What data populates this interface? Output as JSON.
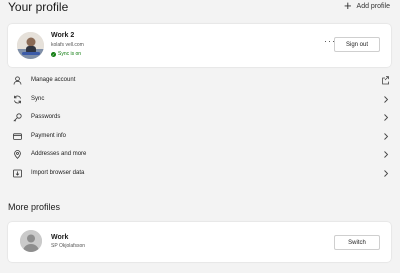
{
  "header": {
    "title": "Your profile",
    "add_profile_label": "Add profile"
  },
  "current_profile": {
    "name": "Work 2",
    "email": "kolafs          vell.com",
    "sync_status": "Sync is on",
    "sign_out_label": "Sign out"
  },
  "menu": {
    "items": [
      {
        "label": "Manage account",
        "icon": "person-icon",
        "trailing": "external-link-icon"
      },
      {
        "label": "Sync",
        "icon": "sync-icon",
        "trailing": "chevron-right-icon"
      },
      {
        "label": "Passwords",
        "icon": "key-icon",
        "trailing": "chevron-right-icon"
      },
      {
        "label": "Payment info",
        "icon": "credit-card-icon",
        "trailing": "chevron-right-icon"
      },
      {
        "label": "Addresses and more",
        "icon": "location-pin-icon",
        "trailing": "chevron-right-icon"
      },
      {
        "label": "Import browser data",
        "icon": "import-icon",
        "trailing": "chevron-right-icon"
      }
    ]
  },
  "more_profiles": {
    "title": "More profiles",
    "profiles": [
      {
        "name": "Work",
        "email": "SP          Okjolafsson",
        "switch_label": "Switch"
      }
    ]
  },
  "colors": {
    "background": "#f3f3f3",
    "card": "#ffffff",
    "sync_green": "#107c10"
  }
}
